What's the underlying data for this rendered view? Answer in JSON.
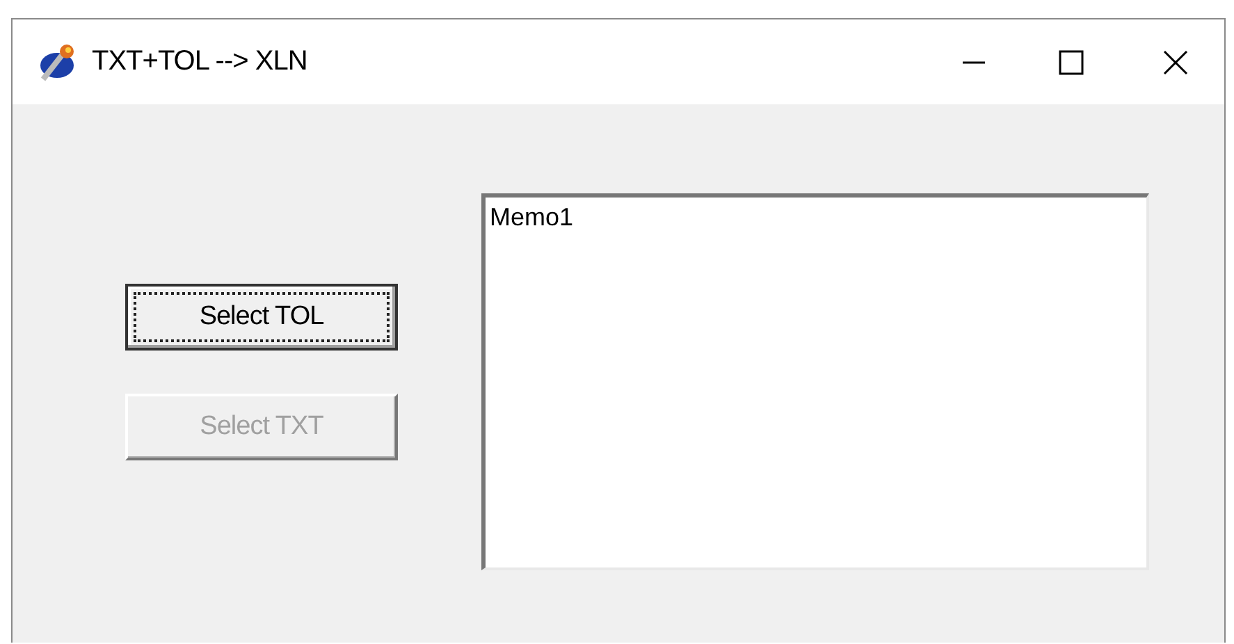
{
  "window": {
    "title": "TXT+TOL --> XLN"
  },
  "buttons": [
    {
      "label": "Select TOL",
      "focused": true,
      "disabled": false
    },
    {
      "label": "Select TXT",
      "focused": false,
      "disabled": true
    }
  ],
  "memo": {
    "value": "Memo1"
  }
}
